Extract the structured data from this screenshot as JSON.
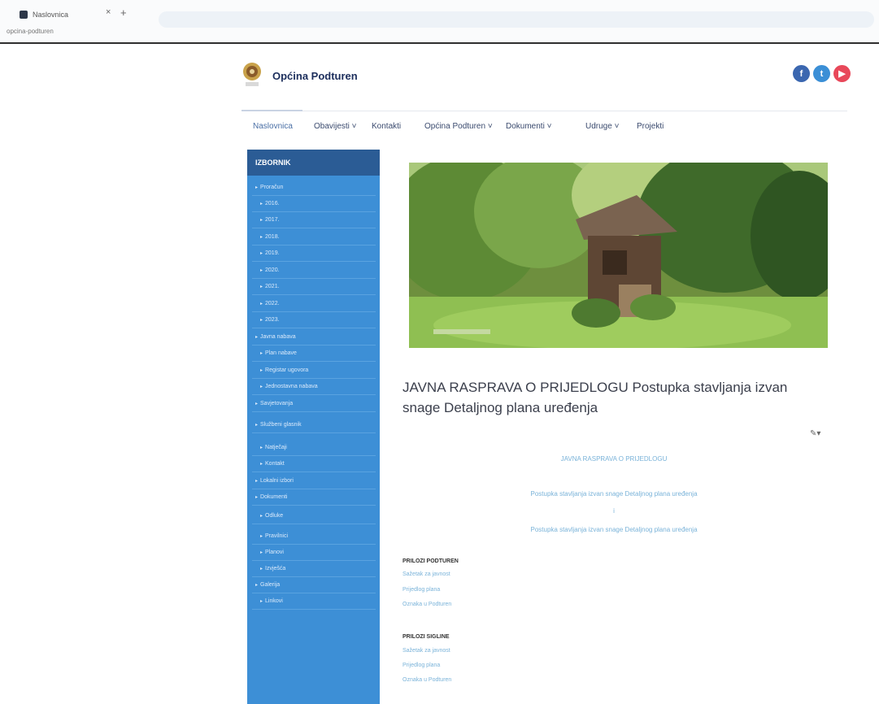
{
  "browser": {
    "tab_title": "Naslovnica",
    "url": "opcina-podturen"
  },
  "site": {
    "title": "Općina Podturen"
  },
  "social": {
    "facebook": "f",
    "twitter": "t",
    "youtube": "▶"
  },
  "nav": {
    "items": [
      "Naslovnica",
      "Obavijesti ˅",
      "Kontakti",
      "Općina Podturen ˅",
      "Dokumenti ˅",
      "Udruge ˅",
      "Projekti"
    ]
  },
  "sidebar": {
    "header": "IZBORNIK",
    "items": [
      "Proračun",
      "2016.",
      "2017.",
      "2018.",
      "2019.",
      "2020.",
      "2021.",
      "2022.",
      "2023.",
      "Javna nabava",
      "Plan nabave",
      "Registar ugovora",
      "Jednostavna nabava",
      "Savjetovanja",
      "Službeni glasnik",
      "Natječaji",
      "Kontakt",
      "Lokalni izbori",
      "Dokumenti",
      "Odluke",
      "Pravilnici",
      "Planovi",
      "Izvješća",
      "Galerija",
      "Linkovi"
    ]
  },
  "article": {
    "title": "JAVNA RASPRAVA O PRIJEDLOGU Postupka stavljanja izvan snage Detaljnog plana uređenja",
    "edit_label": "✎▾",
    "intro_lines": [
      "JAVNA RASPRAVA O PRIJEDLOGU",
      "Postupka stavljanja izvan snage Detaljnog plana uređenja",
      "i",
      "Postupka stavljanja izvan snage Detaljnog plana uređenja"
    ],
    "sections": [
      {
        "heading": "PRILOZI PODTUREN",
        "links": [
          "Sažetak za javnost",
          "Prijedlog plana",
          "Oznaka u Podturen"
        ]
      },
      {
        "heading": "PRILOZI SIGLINE",
        "links": [
          "Sažetak za javnost",
          "Prijedlog plana",
          "Oznaka u Podturen"
        ]
      }
    ]
  }
}
